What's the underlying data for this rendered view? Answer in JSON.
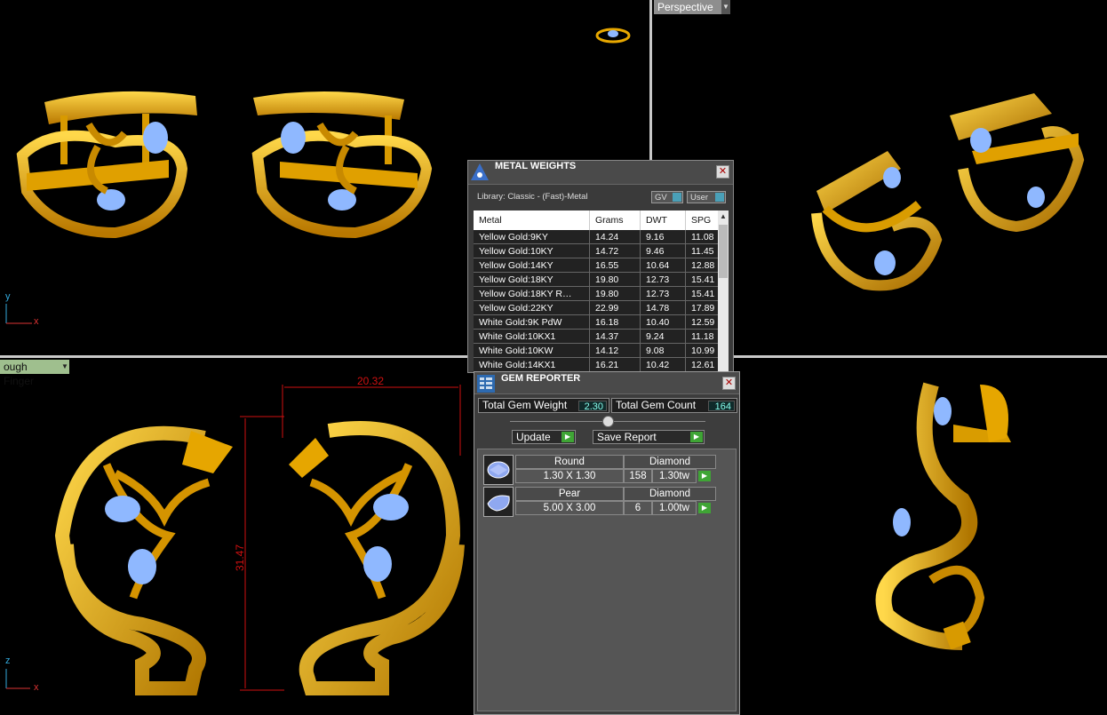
{
  "viewports": {
    "top_right_label": "Perspective",
    "bottom_left_label": "ough Finger",
    "top_left_axes": {
      "x": "x",
      "y": "y"
    },
    "bottom_left_axes": {
      "x": "x",
      "y": "z"
    }
  },
  "dimensions": {
    "width": "20.32",
    "height": "31.47"
  },
  "metal_weights": {
    "title": "METAL WEIGHTS",
    "library": "Library: Classic - (Fast)-Metal",
    "toggles": {
      "gv": "GV",
      "user": "User"
    },
    "columns": [
      "Metal",
      "Grams",
      "DWT",
      "SPG"
    ],
    "rows": [
      [
        "Yellow Gold:9KY",
        "14.24",
        "9.16",
        "11.08"
      ],
      [
        "Yellow Gold:10KY",
        "14.72",
        "9.46",
        "11.45"
      ],
      [
        "Yellow Gold:14KY",
        "16.55",
        "10.64",
        "12.88"
      ],
      [
        "Yellow Gold:18KY",
        "19.80",
        "12.73",
        "15.41"
      ],
      [
        "Yellow Gold:18KY R…",
        "19.80",
        "12.73",
        "15.41"
      ],
      [
        "Yellow Gold:22KY",
        "22.99",
        "14.78",
        "17.89"
      ],
      [
        "White Gold:9K PdW",
        "16.18",
        "10.40",
        "12.59"
      ],
      [
        "White Gold:10KX1",
        "14.37",
        "9.24",
        "11.18"
      ],
      [
        "White Gold:10KW",
        "14.12",
        "9.08",
        "10.99"
      ],
      [
        "White Gold:14KX1",
        "16.21",
        "10.42",
        "12.61"
      ]
    ]
  },
  "gem_reporter": {
    "title": "GEM REPORTER",
    "total_weight_label": "Total Gem Weight",
    "total_weight": "2.30",
    "total_count_label": "Total Gem Count",
    "total_count": "164",
    "update_label": "Update",
    "save_label": "Save Report",
    "gems": [
      {
        "shape": "Round",
        "type": "Diamond",
        "size": "1.30 X 1.30",
        "count": "158",
        "weight": "1.30tw"
      },
      {
        "shape": "Pear",
        "type": "Diamond",
        "size": "5.00 X 3.00",
        "count": "6",
        "weight": "1.00tw"
      }
    ]
  },
  "colors": {
    "gold": "#e8a800",
    "gem": "#8fb8ff",
    "dimension": "#d01010"
  }
}
